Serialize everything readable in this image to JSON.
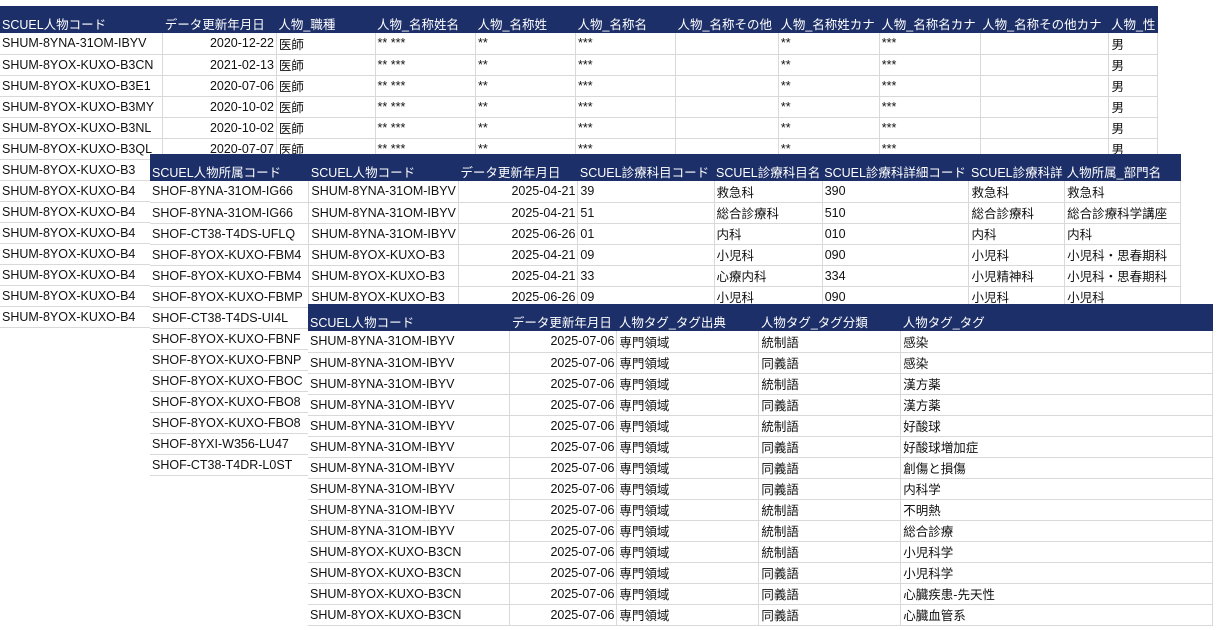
{
  "sheet1": {
    "columns": [
      "SCUEL人物コード",
      "データ更新年月日",
      "人物_職種",
      "人物_名称姓名",
      "人物_名称姓",
      "人物_名称名",
      "人物_名称その他",
      "人物_名称姓カナ",
      "人物_名称名カナ",
      "人物_名称その他カナ",
      "人物_性"
    ],
    "rows": [
      [
        "SHUM-8YNA-31OM-IBYV",
        "2020-12-22",
        "医師",
        "** ***",
        "**",
        "***",
        "",
        "**",
        "***",
        "",
        "男"
      ],
      [
        "SHUM-8YOX-KUXO-B3CN",
        "2021-02-13",
        "医師",
        "** ***",
        "**",
        "***",
        "",
        "**",
        "***",
        "",
        "男"
      ],
      [
        "SHUM-8YOX-KUXO-B3E1",
        "2020-07-06",
        "医師",
        "** ***",
        "**",
        "***",
        "",
        "**",
        "***",
        "",
        "男"
      ],
      [
        "SHUM-8YOX-KUXO-B3MY",
        "2020-10-02",
        "医師",
        "** ***",
        "**",
        "***",
        "",
        "**",
        "***",
        "",
        "男"
      ],
      [
        "SHUM-8YOX-KUXO-B3NL",
        "2020-10-02",
        "医師",
        "** ***",
        "**",
        "***",
        "",
        "**",
        "***",
        "",
        "男"
      ],
      [
        "SHUM-8YOX-KUXO-B3QL",
        "2020-07-07",
        "医師",
        "** ***",
        "**",
        "***",
        "",
        "**",
        "***",
        "",
        "男"
      ],
      [
        "SHUM-8YOX-KUXO-B3",
        "",
        "",
        "",
        "",
        "",
        "",
        "",
        "",
        "",
        ""
      ],
      [
        "SHUM-8YOX-KUXO-B4",
        "",
        "",
        "",
        "",
        "",
        "",
        "",
        "",
        "",
        ""
      ],
      [
        "SHUM-8YOX-KUXO-B4",
        "",
        "",
        "",
        "",
        "",
        "",
        "",
        "",
        "",
        ""
      ],
      [
        "SHUM-8YOX-KUXO-B4",
        "",
        "",
        "",
        "",
        "",
        "",
        "",
        "",
        "",
        ""
      ],
      [
        "SHUM-8YOX-KUXO-B4",
        "",
        "",
        "",
        "",
        "",
        "",
        "",
        "",
        "",
        ""
      ],
      [
        "SHUM-8YOX-KUXO-B4",
        "",
        "",
        "",
        "",
        "",
        "",
        "",
        "",
        "",
        ""
      ],
      [
        "SHUM-8YOX-KUXO-B4",
        "",
        "",
        "",
        "",
        "",
        "",
        "",
        "",
        "",
        ""
      ],
      [
        "SHUM-8YOX-KUXO-B4",
        "",
        "",
        "",
        "",
        "",
        "",
        "",
        "",
        "",
        ""
      ]
    ]
  },
  "sheet2": {
    "columns": [
      "SCUEL人物所属コード",
      "SCUEL人物コード",
      "データ更新年月日",
      "SCUEL診療科目コード",
      "SCUEL診療科目名",
      "SCUEL診療科詳細コード",
      "SCUEL診療科詳",
      "人物所属_部門名"
    ],
    "rows": [
      [
        "SHOF-8YNA-31OM-IG66",
        "SHUM-8YNA-31OM-IBYV",
        "2025-04-21",
        "39",
        "救急科",
        "390",
        "救急科",
        "救急科"
      ],
      [
        "SHOF-8YNA-31OM-IG66",
        "SHUM-8YNA-31OM-IBYV",
        "2025-04-21",
        "51",
        "総合診療科",
        "510",
        "総合診療科",
        "総合診療科学講座"
      ],
      [
        "SHOF-CT38-T4DS-UFLQ",
        "SHUM-8YNA-31OM-IBYV",
        "2025-06-26",
        "01",
        "内科",
        "010",
        "内科",
        "内科"
      ],
      [
        "SHOF-8YOX-KUXO-FBM4",
        "SHUM-8YOX-KUXO-B3",
        "2025-04-21",
        "09",
        "小児科",
        "090",
        "小児科",
        "小児科・思春期科"
      ],
      [
        "SHOF-8YOX-KUXO-FBM4",
        "SHUM-8YOX-KUXO-B3",
        "2025-04-21",
        "33",
        "心療内科",
        "334",
        "小児精神科",
        "小児科・思春期科"
      ],
      [
        "SHOF-8YOX-KUXO-FBMP",
        "SHUM-8YOX-KUXO-B3",
        "2025-06-26",
        "09",
        "小児科",
        "090",
        "小児科",
        "小児科"
      ],
      [
        "SHOF-CT38-T4DS-UI4L",
        "",
        "",
        "",
        "",
        "",
        "",
        ""
      ],
      [
        "SHOF-8YOX-KUXO-FBNF",
        "",
        "",
        "",
        "",
        "",
        "",
        ""
      ],
      [
        "SHOF-8YOX-KUXO-FBNP",
        "",
        "",
        "",
        "",
        "",
        "",
        ""
      ],
      [
        "SHOF-8YOX-KUXO-FBOC",
        "",
        "",
        "",
        "",
        "",
        "",
        ""
      ],
      [
        "SHOF-8YOX-KUXO-FBO8",
        "",
        "",
        "",
        "",
        "",
        "",
        ""
      ],
      [
        "SHOF-8YOX-KUXO-FBO8",
        "",
        "",
        "",
        "",
        "",
        "",
        ""
      ],
      [
        "SHOF-8YXI-W356-LU47",
        "",
        "",
        "",
        "",
        "",
        "",
        ""
      ],
      [
        "SHOF-CT38-T4DR-L0ST",
        "",
        "",
        "",
        "",
        "",
        "",
        ""
      ]
    ]
  },
  "sheet3": {
    "columns": [
      "SCUEL人物コード",
      "データ更新年月日",
      "人物タグ_タグ出典",
      "人物タグ_タグ分類",
      "人物タグ_タグ"
    ],
    "rows": [
      [
        "SHUM-8YNA-31OM-IBYV",
        "2025-07-06",
        "専門領域",
        "統制語",
        "感染"
      ],
      [
        "SHUM-8YNA-31OM-IBYV",
        "2025-07-06",
        "専門領域",
        "同義語",
        "感染"
      ],
      [
        "SHUM-8YNA-31OM-IBYV",
        "2025-07-06",
        "専門領域",
        "統制語",
        "漢方薬"
      ],
      [
        "SHUM-8YNA-31OM-IBYV",
        "2025-07-06",
        "専門領域",
        "同義語",
        "漢方薬"
      ],
      [
        "SHUM-8YNA-31OM-IBYV",
        "2025-07-06",
        "専門領域",
        "統制語",
        "好酸球"
      ],
      [
        "SHUM-8YNA-31OM-IBYV",
        "2025-07-06",
        "専門領域",
        "同義語",
        "好酸球増加症"
      ],
      [
        "SHUM-8YNA-31OM-IBYV",
        "2025-07-06",
        "専門領域",
        "同義語",
        "創傷と損傷"
      ],
      [
        "SHUM-8YNA-31OM-IBYV",
        "2025-07-06",
        "専門領域",
        "同義語",
        "内科学"
      ],
      [
        "SHUM-8YNA-31OM-IBYV",
        "2025-07-06",
        "専門領域",
        "統制語",
        "不明熱"
      ],
      [
        "SHUM-8YNA-31OM-IBYV",
        "2025-07-06",
        "専門領域",
        "統制語",
        "総合診療"
      ],
      [
        "SHUM-8YOX-KUXO-B3CN",
        "2025-07-06",
        "専門領域",
        "統制語",
        "小児科学"
      ],
      [
        "SHUM-8YOX-KUXO-B3CN",
        "2025-07-06",
        "専門領域",
        "同義語",
        "小児科学"
      ],
      [
        "SHUM-8YOX-KUXO-B3CN",
        "2025-07-06",
        "専門領域",
        "同義語",
        "心臓疾患-先天性"
      ],
      [
        "SHUM-8YOX-KUXO-B3CN",
        "2025-07-06",
        "専門領域",
        "同義語",
        "心臓血管系"
      ]
    ]
  }
}
